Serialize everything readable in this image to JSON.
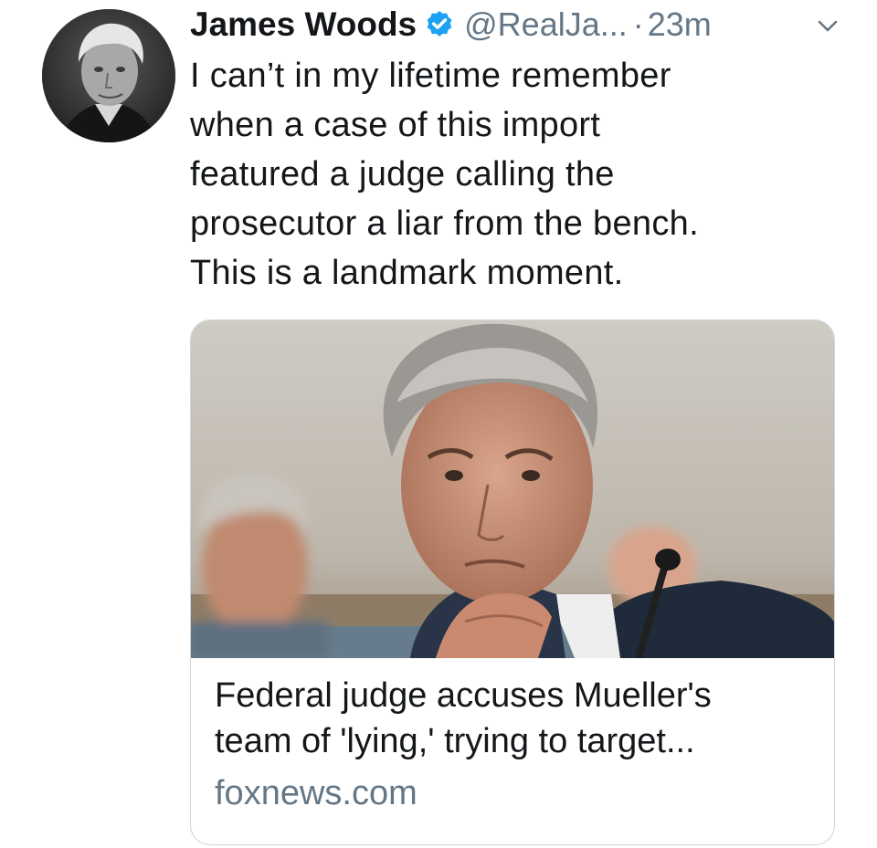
{
  "tweet": {
    "author": {
      "name": "James Woods",
      "handle": "@RealJa...",
      "verified": true
    },
    "separator": "·",
    "timestamp": "23m",
    "text_lines": [
      "I can’t in my lifetime remember",
      "when a case of this import",
      "featured a judge calling the",
      "prosecutor a liar from the bench.",
      "This is a landmark moment."
    ],
    "link_card": {
      "title_lines": [
        "Federal judge accuses Mueller's",
        "team of 'lying,' trying to target..."
      ],
      "domain": "foxnews.com"
    }
  },
  "icons": {
    "verified": "verified-badge-icon",
    "menu": "chevron-down-icon"
  },
  "colors": {
    "text": "#14171a",
    "secondary": "#657786",
    "verified": "#1da1f2",
    "card_border": "#ccd6dd"
  }
}
